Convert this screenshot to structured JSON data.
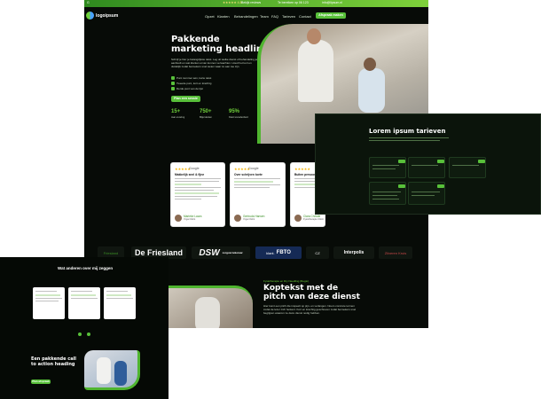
{
  "colors": {
    "accent": "#58c03a",
    "dark": "#070b07",
    "highlight": "#cfe9c4"
  },
  "topbar": {
    "left_text": "G",
    "mid_text": "★★★★★ 4.8",
    "mid_text2": "Bekijk reviews",
    "phone": "Te bereiken op 06 123",
    "mail": "info@lipsum.nl"
  },
  "nav": {
    "logo": "logoipsum",
    "items": [
      "Opzet",
      "Klanten",
      "Behandelingen",
      "Team",
      "FAQ",
      "Tarieven",
      "Contact"
    ],
    "cta": "Afspraak maken"
  },
  "hero": {
    "title": "Pakkende marketing headline",
    "body": "Schrijf je hier je belangrijkste tekst. Leg uit welke dienst of behandeling je aanbiedt en wat klanten ervan kunnen verwachten. Houd het kort en duidelijk zodat bezoekers snel weten waar ze aan toe zijn.",
    "checks": [
      "Punt nummer één, korte tekst",
      "Tweede punt, kort en krachtig",
      "Derde punt van de lijst"
    ],
    "cta": "Plan een sessie",
    "stats": [
      {
        "num": "15+",
        "label": "Jaar ervaring"
      },
      {
        "num": "750+",
        "label": "Blije klanten"
      },
      {
        "num": "95%",
        "label": "Klant tevredenheid"
      }
    ]
  },
  "reviews": [
    {
      "stars": "★★★★★",
      "source": "Google",
      "title": "Makkelijk snel & fijne",
      "name": "Marieke Laura",
      "role": "Yoga Cliënt"
    },
    {
      "stars": "★★★★★",
      "source": "Google",
      "title": "Over schrijven korte",
      "name": "Gertruda Hansen",
      "role": "Yoga Cliënt"
    },
    {
      "stars": "★★★★★",
      "source": "Google",
      "title": "Buiten persoonlijk",
      "name": "Clara Christie",
      "role": "Fysiotherapie Cliënt"
    }
  ],
  "logos": [
    "Friesland",
    "DSW",
    "CZ",
    "Zilveren Kruis",
    "Interpolis"
  ],
  "logos_text": {
    "friesland": "De Friesland",
    "dsw": "DSW",
    "dsw_sub": "zorgverzekeraar",
    "fbto": "FBTO",
    "fbto_pre": "klant.",
    "interpolis": "Interpolis"
  },
  "pricing": {
    "title": "Lorem ipsum tarieven"
  },
  "left_panel": {
    "title": "Wat anderen over mij zeggen",
    "cta_title": "Een pakkende call to action heading",
    "cta_button": "Plan afspraak"
  },
  "pitch": {
    "eyebrow": "Fysiotherapie en Dry Needling (Regio)",
    "title": "Koptekst met de pitch van deze dienst",
    "body": "Hier komt een pitch die inspeelt op pijn- en verlangen. Noem concrete termen zodat de lezer zich herkent. Kort en krachtig geschreven zodat bezoekers snel begrijpen waarom ze deze dienst nodig hebben."
  }
}
